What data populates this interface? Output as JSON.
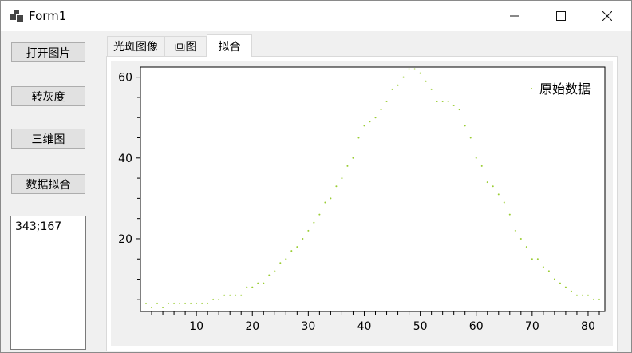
{
  "window": {
    "title": "Form1",
    "icon": "form-app-icon",
    "controls": [
      "minimize-icon",
      "maximize-icon",
      "close-icon"
    ]
  },
  "sidebar": {
    "buttons": [
      {
        "label": "打开图片"
      },
      {
        "label": "转灰度"
      },
      {
        "label": "三维图"
      },
      {
        "label": "数据拟合"
      }
    ],
    "textbox_value": "343;167"
  },
  "tabs": [
    {
      "label": "光斑图像",
      "active": false
    },
    {
      "label": "画图",
      "active": false
    },
    {
      "label": "拟合",
      "active": true
    }
  ],
  "colors": {
    "series": "#9acd32",
    "plot_background": "#ffffff",
    "chart_background": "#f0f0f0"
  },
  "chart_data": {
    "type": "scatter",
    "title": "",
    "xlabel": "",
    "ylabel": "",
    "xlim": [
      0,
      83
    ],
    "ylim": [
      2,
      62.5
    ],
    "xticks": [
      10,
      20,
      30,
      40,
      50,
      60,
      70,
      80
    ],
    "yticks": [
      20,
      40,
      60
    ],
    "grid": false,
    "legend_position": "top-right",
    "series": [
      {
        "name": "原始数据",
        "x": [
          1,
          2,
          3,
          4,
          5,
          6,
          7,
          8,
          9,
          10,
          11,
          12,
          13,
          14,
          15,
          16,
          17,
          18,
          19,
          20,
          21,
          22,
          23,
          24,
          25,
          26,
          27,
          28,
          29,
          30,
          31,
          32,
          33,
          34,
          35,
          36,
          37,
          38,
          39,
          40,
          41,
          42,
          43,
          44,
          45,
          46,
          47,
          48,
          49,
          50,
          51,
          52,
          53,
          54,
          55,
          56,
          57,
          58,
          59,
          60,
          61,
          62,
          63,
          64,
          65,
          66,
          67,
          68,
          69,
          70,
          71,
          72,
          73,
          74,
          75,
          76,
          77,
          78,
          79,
          80,
          81,
          82
        ],
        "y": [
          4,
          3,
          4,
          3,
          4,
          4,
          4,
          4,
          4,
          4,
          4,
          4,
          5,
          5,
          6,
          6,
          6,
          6,
          8,
          8,
          9,
          9,
          11,
          12,
          14,
          15,
          17,
          18,
          20,
          22,
          24,
          26,
          29,
          30,
          33,
          35,
          38,
          40,
          45,
          48,
          49,
          50,
          52,
          54,
          57,
          58,
          60,
          62,
          62,
          61,
          59,
          57,
          54,
          54,
          54,
          53,
          52,
          48,
          45,
          40,
          38,
          34,
          33,
          31,
          29,
          26,
          22,
          20,
          18,
          15,
          15,
          13,
          12,
          10,
          9,
          8,
          7,
          6,
          6,
          6,
          5,
          5
        ]
      }
    ]
  }
}
